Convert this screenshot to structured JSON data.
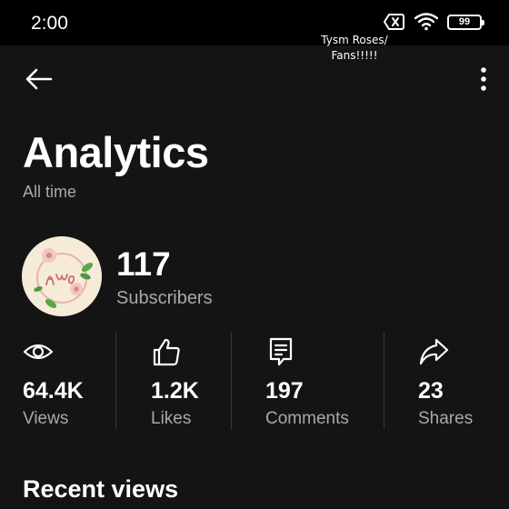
{
  "status_bar": {
    "time": "2:00",
    "battery_level": "99",
    "icons": [
      "close-box-icon",
      "wifi-icon",
      "battery-icon"
    ]
  },
  "overlay_caption": {
    "line1": "Tysm Roses/",
    "line2": "Fans!!!!!"
  },
  "header": {
    "icons": [
      "arrow-left-icon",
      "more-vertical-icon"
    ]
  },
  "page": {
    "title": "Analytics",
    "subtitle": "All time"
  },
  "channel": {
    "subscriber_count": "117",
    "subscriber_label": "Subscribers"
  },
  "stats": [
    {
      "icon": "eye-icon",
      "value": "64.4K",
      "label": "Views"
    },
    {
      "icon": "thumbs-up-icon",
      "value": "1.2K",
      "label": "Likes"
    },
    {
      "icon": "comment-icon",
      "value": "197",
      "label": "Comments"
    },
    {
      "icon": "share-icon",
      "value": "23",
      "label": "Shares"
    }
  ],
  "sections": {
    "recent_views": "Recent views"
  },
  "colors": {
    "background": "#141414",
    "status_bar": "#000000",
    "primary_text": "#ffffff",
    "secondary_text": "#a9a9a9",
    "divider": "#3a3a3a",
    "avatar_background": "#f6ead9"
  }
}
